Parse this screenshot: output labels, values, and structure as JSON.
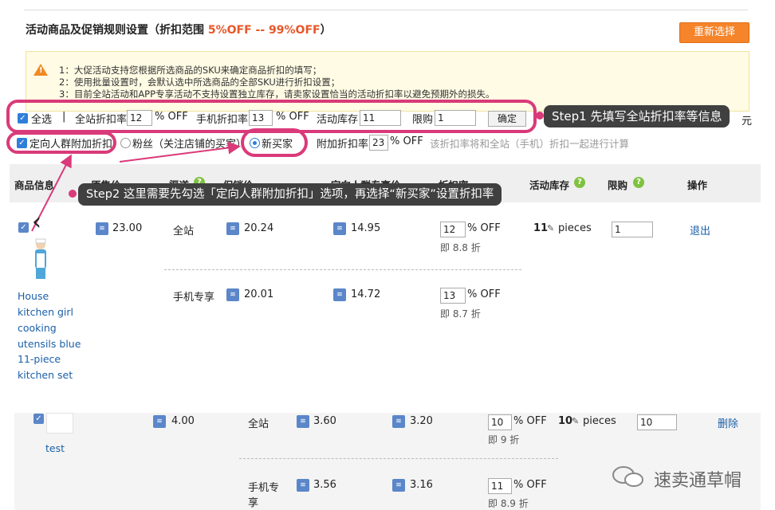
{
  "header": {
    "title_prefix": "活动商品及促销规则设置（折扣范围 ",
    "title_range": "5%OFF -- 99%OFF",
    "title_suffix": "）",
    "reset_button": "重新选择"
  },
  "notice": {
    "lines": [
      "1：大促活动支持您根据所选商品的SKU来确定商品折扣的填写；",
      "2：使用批量设置时，会默认选中所选商品的全部SKU进行折扣设置；",
      "3：目前全站活动和APP专享活动不支持设置独立库存，请卖家设置恰当的活动折扣率以避免预期外的损失。"
    ]
  },
  "batch": {
    "select_all": "全选",
    "sep": "|",
    "site_discount_label": "全站折扣率",
    "site_discount_value": "12",
    "site_off": "% OFF",
    "mobile_discount_label": "手机折扣率",
    "mobile_discount_value": "13",
    "mobile_off": "% OFF",
    "stock_label": "活动库存",
    "stock_value": "11",
    "limit_label": "限购",
    "limit_value": "1",
    "confirm_button": "确定",
    "trailing": "元"
  },
  "targeted": {
    "checkbox_label": "定向人群附加折扣",
    "fans_label": "粉丝（关注店铺的买家）",
    "new_buyer_label": "新买家",
    "extra_label": "附加折扣率",
    "extra_value": "23",
    "extra_off": "% OFF",
    "hint": "该折扣率将和全站（手机）折扣一起进行计算"
  },
  "callouts": {
    "step1": "Step1 先填写全站折扣率等信息",
    "step2": "Step2 这里需要先勾选「定向人群附加折扣」选项，再选择“新买家”设置折扣率"
  },
  "table": {
    "headers": {
      "product": "商品信息",
      "original": "原售价",
      "channel": "渠道",
      "promo": "促销价",
      "targeted": "定向人群专享价",
      "discount": "折扣率",
      "stock": "活动库存",
      "limit": "限购",
      "action": "操作"
    }
  },
  "product1": {
    "name": [
      "House",
      "kitchen girl",
      "cooking",
      "utensils blue",
      "11-piece",
      "kitchen set"
    ],
    "original_price": "23.00",
    "rows": [
      {
        "channel": "全站",
        "promo": "20.24",
        "targeted": "14.95",
        "discount": "12",
        "off": "% OFF",
        "equiv": "即 8.8 折",
        "stock": "11",
        "pieces": "pieces",
        "limit": "1",
        "action": "退出"
      },
      {
        "channel": "手机专享",
        "promo": "20.01",
        "targeted": "14.72",
        "discount": "13",
        "off": "% OFF",
        "equiv": "即 8.7 折"
      }
    ]
  },
  "product2": {
    "name": "test",
    "original_price": "4.00",
    "rows": [
      {
        "channel": "全站",
        "promo": "3.60",
        "targeted": "3.20",
        "discount": "10",
        "off": "% OFF",
        "equiv": "即 9 折",
        "stock": "10",
        "pieces": "pieces",
        "limit": "10",
        "action": "删除"
      },
      {
        "channel_l1": "手机专",
        "channel_l2": "享",
        "promo": "3.56",
        "targeted": "3.16",
        "discount": "11",
        "off": "% OFF",
        "equiv": "即 8.9 折"
      }
    ]
  },
  "watermark": "速卖通草帽",
  "colors": {
    "accent_orange": "#f5842a",
    "highlight_pink": "#d93a7a",
    "tag_blue": "#5b86c9",
    "help_green": "#7fc241",
    "link_blue": "#1a5fa8"
  }
}
